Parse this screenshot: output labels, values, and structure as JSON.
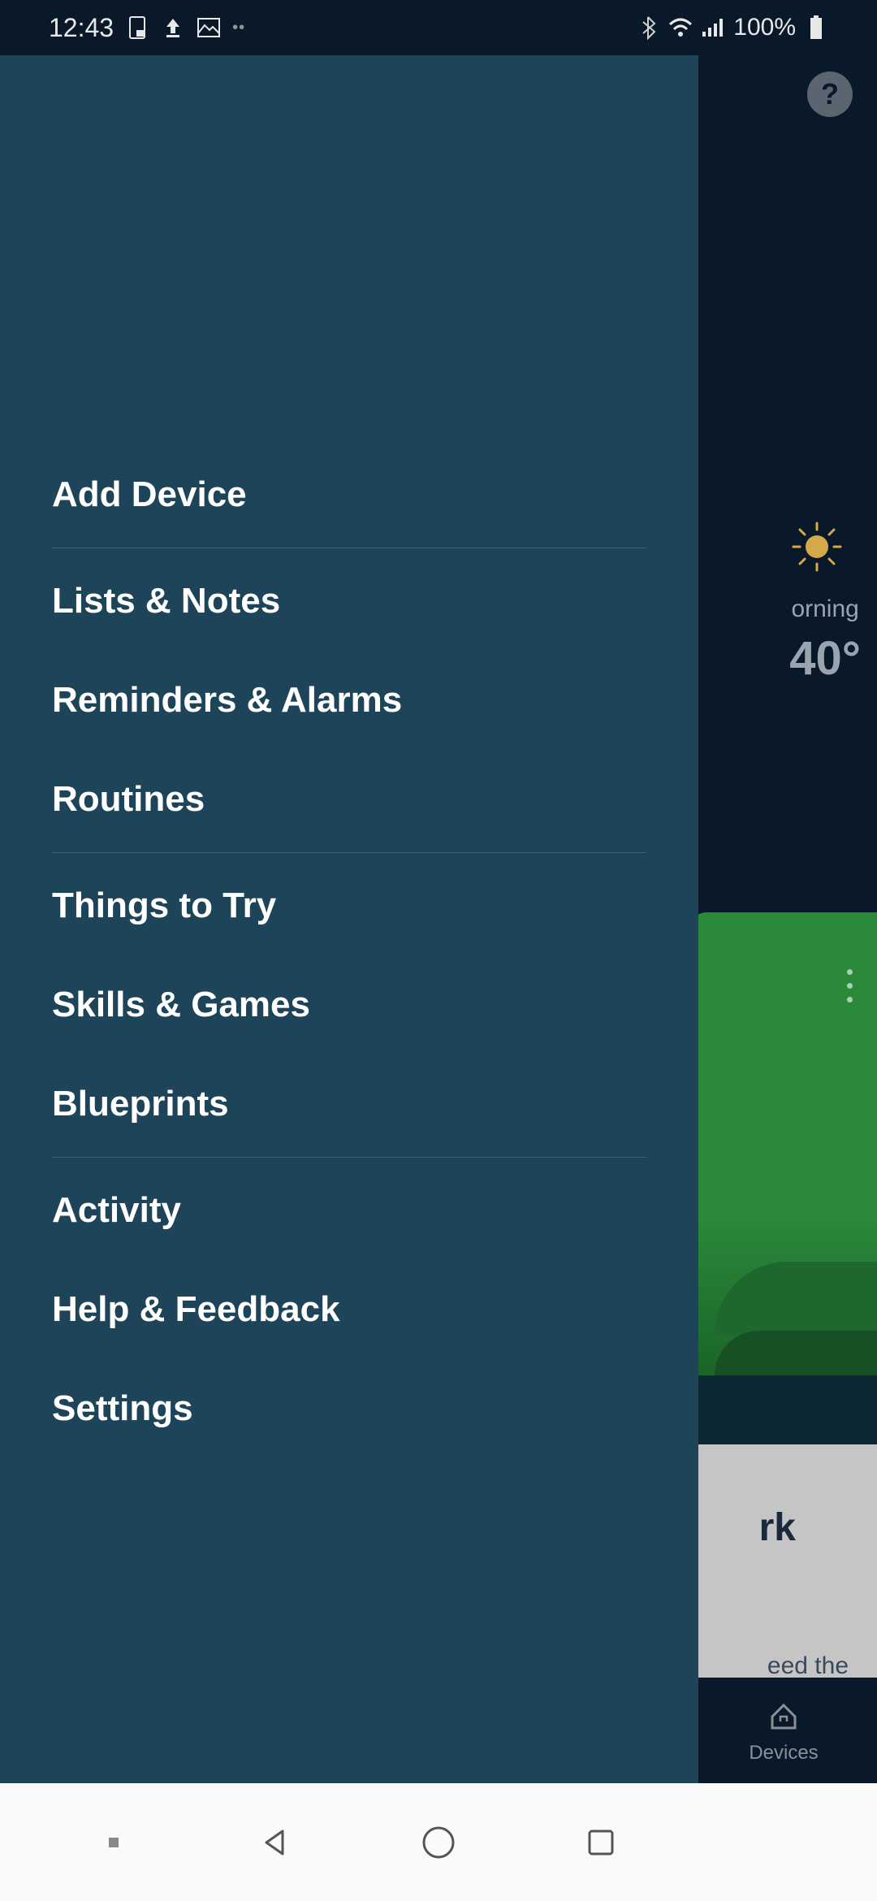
{
  "status_bar": {
    "time": "12:43",
    "battery_percent": "100%"
  },
  "drawer": {
    "items": [
      {
        "label": "Add Device"
      },
      {
        "label": "Lists & Notes"
      },
      {
        "label": "Reminders & Alarms"
      },
      {
        "label": "Routines"
      },
      {
        "label": "Things to Try"
      },
      {
        "label": "Skills & Games"
      },
      {
        "label": "Blueprints"
      },
      {
        "label": "Activity"
      },
      {
        "label": "Help & Feedback"
      },
      {
        "label": "Settings"
      }
    ]
  },
  "background": {
    "weather": {
      "time_of_day_fragment": "orning",
      "temperature": "40°"
    },
    "gray_card": {
      "title_fragment": "rk",
      "body_fragment": "eed the"
    },
    "bottom_tab": {
      "label": "Devices"
    }
  }
}
